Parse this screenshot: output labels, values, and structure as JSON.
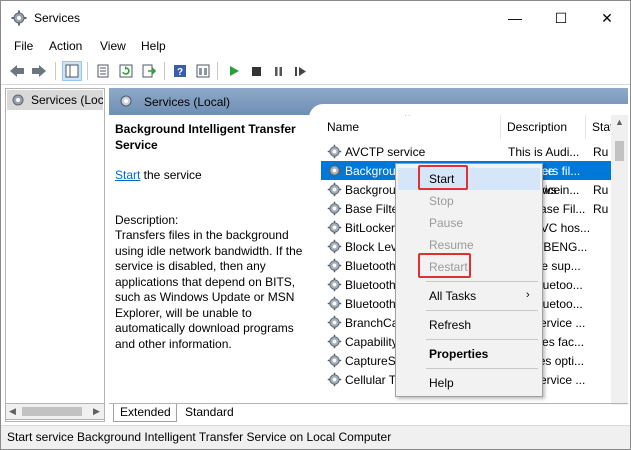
{
  "window": {
    "title": "Services"
  },
  "title_controls": {
    "minimize": "—",
    "maximize": "☐",
    "close": "✕"
  },
  "menu": [
    "File",
    "Action",
    "View",
    "Help"
  ],
  "tree": {
    "item": "Services (Local)"
  },
  "main_header": {
    "title": "Services (Local)"
  },
  "detail": {
    "service_title": "Background Intelligent Transfer Service",
    "start_link": "Start",
    "start_suffix": " the service",
    "description_label": "Description:",
    "description": "Transfers files in the background using idle network bandwidth. If the service is disabled, then any applications that depend on BITS, such as Windows Update or MSN Explorer, will be unable to automatically download programs and other information."
  },
  "columns": {
    "name": "Name",
    "description": "Description",
    "status": "Status",
    "sort_indicator": "^"
  },
  "services": [
    {
      "name": "AVCTP service",
      "description": "This is Audi...",
      "status": "Ru"
    },
    {
      "name": "Background Intelligent Transfer Service",
      "description": "Transfers fil...",
      "status": ""
    },
    {
      "name": "Background Tasks Infrastructure Service",
      "description": "Windows in...",
      "status": "Ru"
    },
    {
      "name": "Base Filtering Engine",
      "description": "The Base Fil...",
      "status": "Ru"
    },
    {
      "name": "BitLocker Drive Encryption Service",
      "description": "BDESVC hos...",
      "status": ""
    },
    {
      "name": "Block Level Backup Engine Service",
      "description": "The WBENG...",
      "status": ""
    },
    {
      "name": "Bluetooth Audio Gateway Service",
      "description": "Service sup...",
      "status": ""
    },
    {
      "name": "Bluetooth Support Service",
      "description": "The Bluetoo...",
      "status": ""
    },
    {
      "name": "Bluetooth User Support Service",
      "description": "The Bluetoo...",
      "status": ""
    },
    {
      "name": "BranchCache",
      "description": "This service ...",
      "status": ""
    },
    {
      "name": "Capability Access Manager Service",
      "description": "Provides fac...",
      "status": ""
    },
    {
      "name": "CaptureService",
      "description": "Enables opti...",
      "status": ""
    },
    {
      "name": "Cellular Time",
      "description": "This service ...",
      "status": ""
    }
  ],
  "context_menu": {
    "start": "Start",
    "stop": "Stop",
    "pause": "Pause",
    "resume": "Resume",
    "restart": "Restart",
    "all_tasks": "All Tasks",
    "refresh": "Refresh",
    "properties": "Properties",
    "help": "Help"
  },
  "tabs": {
    "extended": "Extended",
    "standard": "Standard"
  },
  "status_bar": "Start service Background Intelligent Transfer Service on Local Computer",
  "colors": {
    "selection": "#0078d7",
    "highlight_box": "#e03030",
    "link": "#0066cc",
    "header_band": "#7f9cc0"
  },
  "icons": [
    "gear-icon",
    "back-arrow-icon",
    "forward-arrow-icon",
    "console-tree-icon",
    "properties-icon",
    "refresh-icon",
    "export-icon",
    "help-icon",
    "console-icon",
    "play-icon",
    "stop-icon",
    "pause-icon",
    "restart-icon"
  ]
}
